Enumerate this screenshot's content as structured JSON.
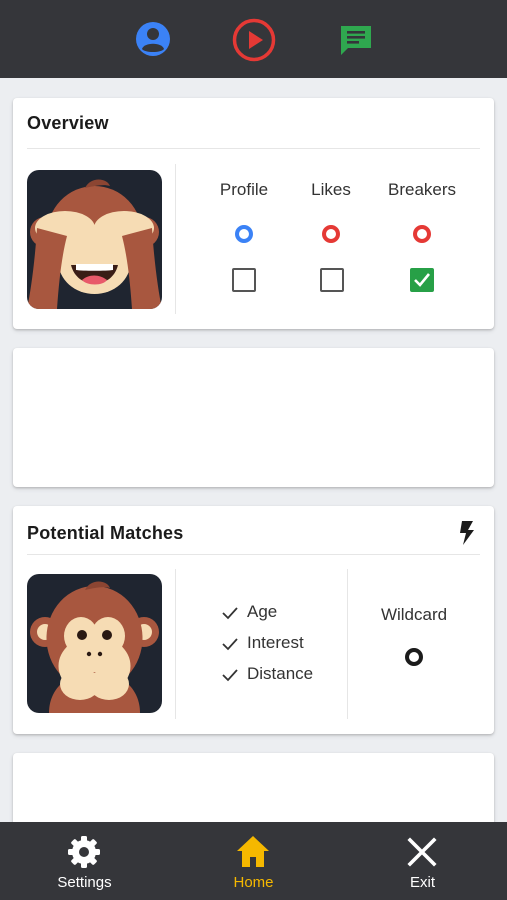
{
  "topbar": {
    "icons": [
      "profile-icon",
      "play-icon",
      "chat-icon"
    ]
  },
  "overview": {
    "title": "Overview",
    "avatar": "see-no-evil-monkey",
    "columns": [
      {
        "label": "Profile",
        "ring_color": "#3b82f6",
        "checked": false
      },
      {
        "label": "Likes",
        "ring_color": "#e53935",
        "checked": false
      },
      {
        "label": "Breakers",
        "ring_color": "#e53935",
        "checked": true
      }
    ]
  },
  "potential_matches": {
    "title": "Potential Matches",
    "action_icon": "bolt-icon",
    "avatar": "speak-no-evil-monkey",
    "criteria": [
      "Age",
      "Interest",
      "Distance"
    ],
    "wildcard_label": "Wildcard"
  },
  "bottom_nav": {
    "items": [
      {
        "label": "Settings",
        "icon": "gear-icon",
        "color": "#ffffff"
      },
      {
        "label": "Home",
        "icon": "home-icon",
        "color": "#f5b800"
      },
      {
        "label": "Exit",
        "icon": "close-icon",
        "color": "#ffffff"
      }
    ]
  },
  "colors": {
    "bar": "#35363a",
    "accent": "#f5b800",
    "blue": "#3b82f6",
    "red": "#e53935",
    "green": "#27a047"
  }
}
